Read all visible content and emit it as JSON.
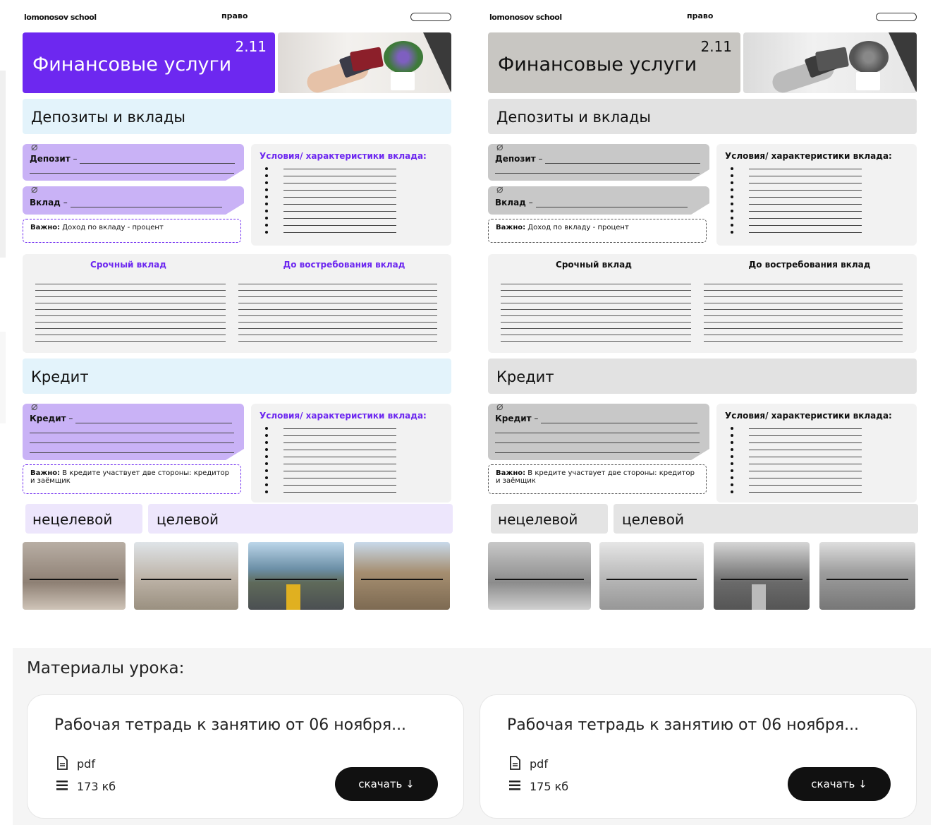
{
  "worksheets": [
    {
      "variant": "color",
      "brand": "lomonosov school",
      "subject": "право",
      "lesson_number": "2.11",
      "title": "Финансовые услуги",
      "section_deposits": "Депозиты и вклады",
      "deposit_label": "Депозит",
      "vklad_label": "Вклад",
      "note1_bold": "Важно:",
      "note1_text": "Доход по вкладу - процент",
      "conditions_heading": "Условия/ характеристики вклада:",
      "term_deposit": "Срочный вклад",
      "demand_deposit": "До востребования вклад",
      "section_credit": "Кредит",
      "credit_label": "Кредит",
      "note2_bold": "Важно:",
      "note2_text": "В кредите участвует две стороны: кредитор и заёмщик",
      "conditions_heading2": "Условия/ характеристики вклада:",
      "tag_untargeted": "нецелевой",
      "tag_targeted": "целевой"
    },
    {
      "variant": "grayscale",
      "brand": "lomonosov school",
      "subject": "право",
      "lesson_number": "2.11",
      "title": "Финансовые услуги",
      "section_deposits": "Депозиты и вклады",
      "deposit_label": "Депозит",
      "vklad_label": "Вклад",
      "note1_bold": "Важно:",
      "note1_text": "Доход по вкладу - процент",
      "conditions_heading": "Условия/ характеристики вклада:",
      "term_deposit": "Срочный вклад",
      "demand_deposit": "До востребования вклад",
      "section_credit": "Кредит",
      "credit_label": "Кредит",
      "note2_bold": "Важно:",
      "note2_text": "В кредите участвует две стороны: кредитор и заёмщик",
      "conditions_heading2": "Условия/ характеристики вклада:",
      "tag_untargeted": "нецелевой",
      "tag_targeted": "целевой"
    }
  ],
  "materials": {
    "heading": "Материалы урока:",
    "files": [
      {
        "title": "Рабочая тетрадь к занятию от 06 ноября...",
        "type": "pdf",
        "size": "173 кб",
        "button": "скачать ↓"
      },
      {
        "title": "Рабочая тетрадь к занятию от 06 ноября...",
        "type": "pdf",
        "size": "175 кб",
        "button": "скачать ↓"
      }
    ]
  },
  "colors": {
    "accent": "#6d28f0",
    "light_blue": "#e3f3fb",
    "lilac": "#c9b2f6",
    "button": "#111111"
  },
  "icons": {
    "file": "document-icon",
    "size": "list-icon",
    "download": "arrow-down-icon",
    "clip": "paperclip-icon"
  }
}
